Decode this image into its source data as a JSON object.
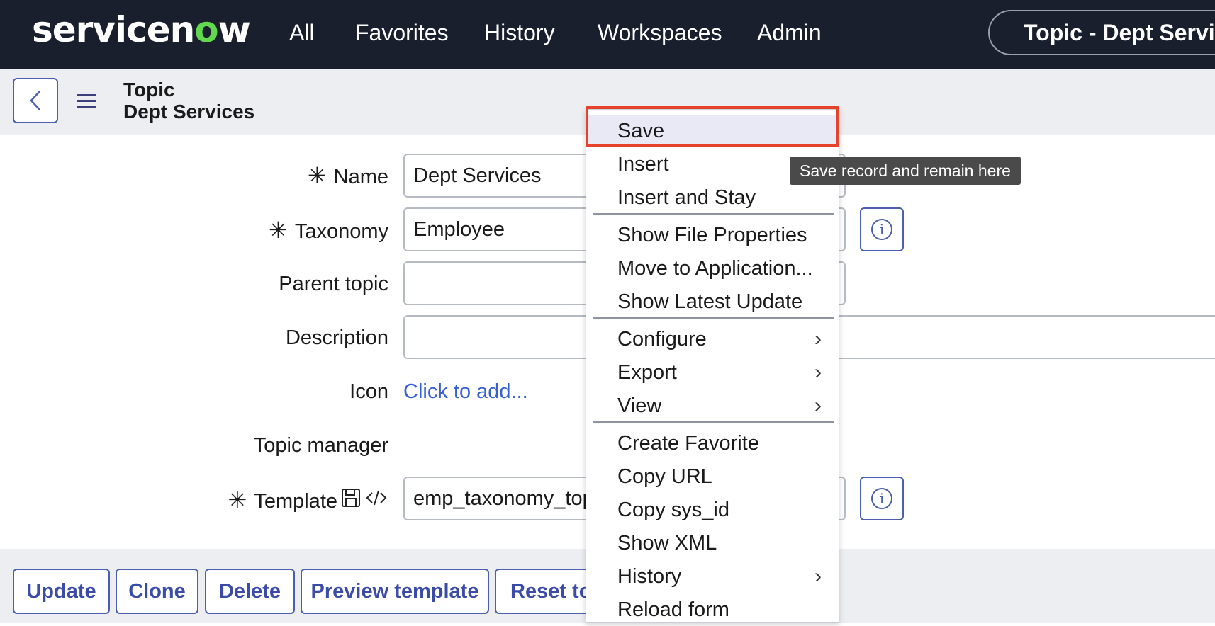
{
  "nav": {
    "brand": "servicenow",
    "links": [
      "All",
      "Favorites",
      "History",
      "Workspaces",
      "Admin"
    ],
    "title_pill": "Topic - Dept Services"
  },
  "header": {
    "record_type": "Topic",
    "record_name": "Dept Services"
  },
  "form": {
    "name_label": "Name",
    "name_value": "Dept Services",
    "taxonomy_label": "Taxonomy",
    "taxonomy_value": "Employee",
    "parent_label": "Parent topic",
    "parent_value": "",
    "description_label": "Description",
    "description_value": "",
    "icon_label": "Icon",
    "icon_link": "Click to add...",
    "manager_label": "Topic manager",
    "template_label": "Template",
    "template_value": "emp_taxonomy_topi"
  },
  "buttons": [
    "Update",
    "Clone",
    "Delete",
    "Preview template",
    "Reset to"
  ],
  "context_menu": {
    "items": [
      {
        "label": "Save",
        "submenu": false
      },
      {
        "label": "Insert",
        "submenu": false
      },
      {
        "label": "Insert and Stay",
        "submenu": false
      },
      {
        "label": "Show File Properties",
        "submenu": false
      },
      {
        "label": "Move to Application...",
        "submenu": false
      },
      {
        "label": "Show Latest Update",
        "submenu": false
      },
      {
        "label": "Configure",
        "submenu": true
      },
      {
        "label": "Export",
        "submenu": true
      },
      {
        "label": "View",
        "submenu": true
      },
      {
        "label": "Create Favorite",
        "submenu": false
      },
      {
        "label": "Copy URL",
        "submenu": false
      },
      {
        "label": "Copy sys_id",
        "submenu": false
      },
      {
        "label": "Show XML",
        "submenu": false
      },
      {
        "label": "History",
        "submenu": true
      },
      {
        "label": "Reload form",
        "submenu": false
      }
    ],
    "active_item": "Save"
  },
  "tooltip": "Save record and remain here",
  "colors": {
    "nav_bg": "#1a1f2e",
    "accent": "#4b5fb0",
    "link": "#3660d4",
    "highlight_border": "#e5432b",
    "brand_o": "#62d84e"
  }
}
